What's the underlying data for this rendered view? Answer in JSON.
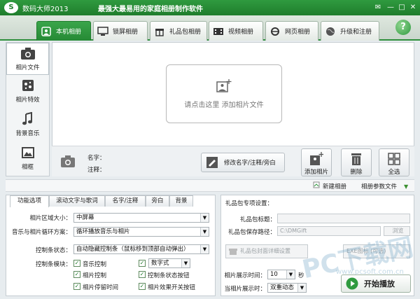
{
  "app": {
    "name": "数码大师2013",
    "slogan": "最强大最易用的家庭相册制作软件"
  },
  "window_controls": {
    "feedback": "✉",
    "minimize": "—",
    "maximize": "□",
    "close": "✕"
  },
  "top_tabs": [
    {
      "label": "本机相册",
      "icon": "photo-album-icon",
      "active": true
    },
    {
      "label": "锁屏相册",
      "icon": "monitor-icon",
      "active": false
    },
    {
      "label": "礼品包相册",
      "icon": "gift-icon",
      "active": false
    },
    {
      "label": "视频相册",
      "icon": "film-icon",
      "active": false
    },
    {
      "label": "网页相册",
      "icon": "ie-browser-icon",
      "active": false
    },
    {
      "label": "升级和注册",
      "icon": "globe-icon",
      "active": false
    }
  ],
  "help": "?",
  "sidebar": [
    {
      "label": "相片文件",
      "icon": "camera-icon",
      "active": true
    },
    {
      "label": "相片特效",
      "icon": "effects-icon",
      "active": false
    },
    {
      "label": "背景音乐",
      "icon": "music-note-icon",
      "active": false
    },
    {
      "label": "相框",
      "icon": "frame-icon",
      "active": false
    }
  ],
  "dropzone": {
    "text": "请点击这里 添加相片文件"
  },
  "photo_info": {
    "name_label": "名字：",
    "comment_label": "注释："
  },
  "buttons": {
    "edit": "修改名字/注释/旁白",
    "add_photo": "添加相片",
    "delete": "删除",
    "select_all": "全选"
  },
  "links": {
    "new_album": "新建相册",
    "album_params": "相册参数文件"
  },
  "sub_tabs": [
    {
      "label": "功能选项",
      "active": true
    },
    {
      "label": "滚动文字与歌词",
      "active": false
    },
    {
      "label": "名字/注释",
      "active": false
    },
    {
      "label": "旁白",
      "active": false
    },
    {
      "label": "背景",
      "active": false
    }
  ],
  "options": {
    "area_size_label": "相片区域大小：",
    "area_size_value": "中屏幕",
    "loop_label": "音乐与相片循环方案：",
    "loop_value": "循环播放音乐与相片",
    "control_label": "控制条状态：",
    "control_value": "自动隐藏控制条（鼠标移到顶部自动弹出）",
    "module_label": "控制条模块：",
    "checkboxes": [
      {
        "label": "音乐控制",
        "checked": true
      },
      {
        "label": "相片控制",
        "checked": true
      },
      {
        "label": "相片停留时间",
        "checked": true
      },
      {
        "label": "控制条状态按钮",
        "checked": true
      },
      {
        "label": "相片效果开关按钮",
        "checked": true
      }
    ],
    "digit_style": "数字式"
  },
  "gift_settings": {
    "title": "礼品包专项设置：",
    "gift_title_label": "礼品包标题：",
    "gift_title_value": "",
    "save_path_label": "礼品包保存路径：",
    "save_path_value": "C:\\DMGift",
    "browse": "浏览",
    "detail_btn": "礼品包封面详细设置",
    "exe_icon_btn": "EXE图标 (可选)"
  },
  "display": {
    "time_label": "相片展示时间：",
    "time_value": "10",
    "time_unit": "秒",
    "mode_label": "当相片展示时：",
    "mode_value": "双重动态"
  },
  "play": "开始播放",
  "watermark": {
    "brand": "PC下载网",
    "url": "www.pcsoft.com.cn"
  },
  "colors": {
    "brand_green": "#2f9a3f",
    "tab_active": "#2e8f3c",
    "checkbox_green": "#1f7d2c"
  }
}
